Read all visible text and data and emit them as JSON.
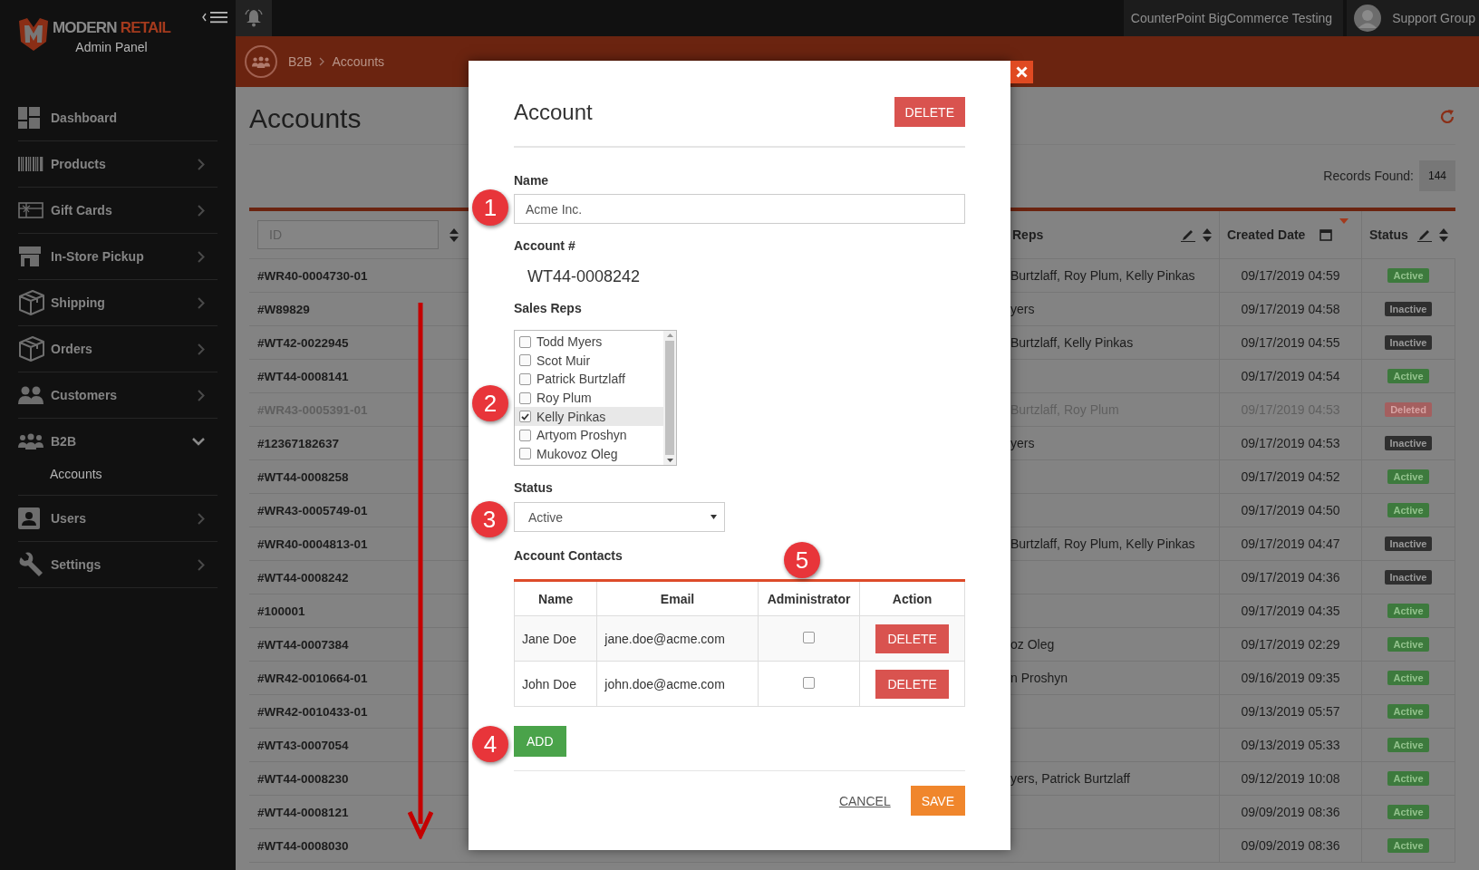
{
  "sidebar": {
    "logo": {
      "brand_first": "MODERN",
      "brand_second": "RETAIL",
      "subtitle": "Admin Panel"
    },
    "items": [
      {
        "label": "Dashboard",
        "kind": "link"
      },
      {
        "label": "Products",
        "kind": "group",
        "expanded": false
      },
      {
        "label": "Gift Cards",
        "kind": "group",
        "expanded": false
      },
      {
        "label": "In-Store Pickup",
        "kind": "group",
        "expanded": false
      },
      {
        "label": "Shipping",
        "kind": "group",
        "expanded": false
      },
      {
        "label": "Orders",
        "kind": "group",
        "expanded": false
      },
      {
        "label": "Customers",
        "kind": "group",
        "expanded": false
      },
      {
        "label": "B2B",
        "kind": "group",
        "expanded": true,
        "children": [
          {
            "label": "Accounts"
          }
        ]
      },
      {
        "label": "Users",
        "kind": "group",
        "expanded": false
      },
      {
        "label": "Settings",
        "kind": "group",
        "expanded": false
      }
    ]
  },
  "top_bar": {
    "store": "CounterPoint BigCommerce Testing",
    "user": "Support Group"
  },
  "breadcrumb": [
    "B2B",
    "Accounts"
  ],
  "page": {
    "title": "Accounts",
    "records_label": "Records Found:",
    "records_count": "144"
  },
  "table": {
    "columns": [
      {
        "kind": "filter",
        "placeholder": "ID",
        "sorted": false
      },
      {
        "kind": "editable",
        "label": "Reps",
        "sorted": false
      },
      {
        "kind": "date",
        "label": "Created Date",
        "sorted": true
      },
      {
        "kind": "editable",
        "label": "Status",
        "sorted": false
      }
    ],
    "rows": [
      {
        "id": "#WR40-0004730-01",
        "reps": "Burtzlaff, Roy Plum, Kelly Pinkas",
        "created": "09/17/2019 04:59",
        "status": "Active",
        "kind": "active"
      },
      {
        "id": "#W89829",
        "reps": "yers",
        "created": "09/17/2019 04:58",
        "status": "Inactive",
        "kind": "inactive"
      },
      {
        "id": "#WT42-0022945",
        "reps": "Burtzlaff, Kelly Pinkas",
        "created": "09/17/2019 04:55",
        "status": "Inactive",
        "kind": "inactive"
      },
      {
        "id": "#WT44-0008141",
        "created": "09/17/2019 04:54",
        "status": "Active",
        "kind": "active"
      },
      {
        "id": "#WR43-0005391-01",
        "reps": "Burtzlaff, Roy Plum",
        "created": "09/17/2019 04:53",
        "status": "Deleted",
        "kind": "deleted"
      },
      {
        "id": "#12367182637",
        "reps": "yers",
        "created": "09/17/2019 04:53",
        "status": "Inactive",
        "kind": "inactive"
      },
      {
        "id": "#WT44-0008258",
        "created": "09/17/2019 04:52",
        "status": "Active",
        "kind": "active"
      },
      {
        "id": "#WR43-0005749-01",
        "created": "09/17/2019 04:50",
        "status": "Active",
        "kind": "active"
      },
      {
        "id": "#WR40-0004813-01",
        "reps": "Burtzlaff, Roy Plum, Kelly Pinkas",
        "created": "09/17/2019 04:47",
        "status": "Inactive",
        "kind": "inactive"
      },
      {
        "id": "#WT44-0008242",
        "created": "09/17/2019 04:36",
        "status": "Inactive",
        "kind": "inactive"
      },
      {
        "id": "#100001",
        "created": "09/17/2019 04:35",
        "status": "Active",
        "kind": "active"
      },
      {
        "id": "#WT44-0007384",
        "reps": "oz Oleg",
        "created": "09/17/2019 02:29",
        "status": "Active",
        "kind": "active"
      },
      {
        "id": "#WR42-0010664-01",
        "reps": "n Proshyn",
        "created": "09/16/2019 09:35",
        "status": "Active",
        "kind": "active"
      },
      {
        "id": "#WR42-0010433-01",
        "created": "09/13/2019 05:57",
        "status": "Active",
        "kind": "active"
      },
      {
        "id": "#WT43-0007054",
        "created": "09/13/2019 05:33",
        "status": "Active",
        "kind": "active"
      },
      {
        "id": "#WT44-0008230",
        "reps": "yers, Patrick Burtzlaff",
        "created": "09/12/2019 10:08",
        "status": "Active",
        "kind": "active"
      },
      {
        "id": "#WT44-0008121",
        "created": "09/09/2019 08:36",
        "status": "Active",
        "kind": "active"
      },
      {
        "id": "#WT44-0008030",
        "created": "09/09/2019 08:36",
        "status": "Active",
        "kind": "active"
      }
    ]
  },
  "modal": {
    "title": "Account",
    "delete_label": "DELETE",
    "name_label": "Name",
    "name_value": "Acme Inc.",
    "account_label": "Account #",
    "account_value": "WT44-0008242",
    "reps_label": "Sales Reps",
    "reps": [
      {
        "name": "Todd Myers",
        "checked": false
      },
      {
        "name": "Scot Muir",
        "checked": false
      },
      {
        "name": "Patrick Burtzlaff",
        "checked": false
      },
      {
        "name": "Roy Plum",
        "checked": false
      },
      {
        "name": "Kelly Pinkas",
        "checked": true
      },
      {
        "name": "Artyom Proshyn",
        "checked": false
      },
      {
        "name": "Mukovoz Oleg",
        "checked": false
      }
    ],
    "status_label": "Status",
    "status_value": "Active",
    "contacts_label": "Account Contacts",
    "contacts": {
      "columns": [
        "Name",
        "Email",
        "Administrator",
        "Action"
      ],
      "rows": [
        {
          "name": "Jane Doe",
          "email": "jane.doe@acme.com",
          "administrator": false,
          "action": "DELETE"
        },
        {
          "name": "John Doe",
          "email": "john.doe@acme.com",
          "administrator": false,
          "action": "DELETE"
        }
      ]
    },
    "add_label": "ADD",
    "cancel_label": "CANCEL",
    "save_label": "SAVE"
  },
  "annotations": {
    "markers": [
      "1",
      "2",
      "3",
      "4",
      "5"
    ]
  }
}
